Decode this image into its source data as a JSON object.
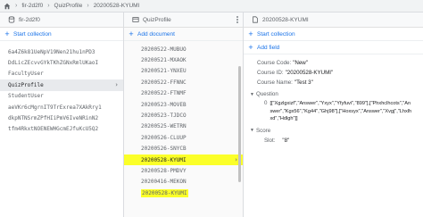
{
  "breadcrumb": [
    "fir-2d2f0",
    "QuizProfile",
    "20200528-KYUMI"
  ],
  "col1": {
    "title": "fir-2d2f0",
    "add_label": "Start collection",
    "items": [
      "6a4Z6k81UeNpV19Nen21hu1nPD3",
      "DdLicZEcvvGYkTKhZGNxRmlUKaoI",
      "FacultyUser",
      "QuizProfile",
      "StudentUser",
      "aeVKr6cMgrnIT9TrExrea7XAkRry1",
      "dkpNTNSrmZPfHIiPmV6IveNRinN2",
      "tfm4RkxtNOENEWHGcmEJfuKcU5Q2"
    ],
    "selected_index": 3
  },
  "col2": {
    "title": "QuizProfile",
    "add_label": "Add document",
    "items": [
      "20200522-MUBUO",
      "20200521-MXAOK",
      "20200521-YNXEU",
      "20200522-FFNNC",
      "20200522-FTNMF",
      "20200523-MOVEB",
      "20200523-TJDCO",
      "20200525-WETRN",
      "20200526-CLUUP",
      "20200526-SNYCB",
      "20200528-KYUMI",
      "20200528-PMDVY",
      "20200416-MEKON",
      "20200528-KYUMI"
    ]
  },
  "col3": {
    "title": "20200528-KYUMI",
    "start_collection": "Start collection",
    "add_field": "Add field",
    "fields": {
      "course_code": {
        "key": "Course Code:",
        "value": "\"New\""
      },
      "course_id": {
        "key": "Course ID:",
        "value": "\"20200528-KYUMI\""
      },
      "course_name": {
        "key": "Course Name:",
        "value": "\"Test 3\""
      },
      "question": {
        "key": "Question",
        "index": "0",
        "value": "[[\"Xgzlgxizf\",\"Answer\",\"Yxyx\",\"Yfyfuvi\",\"899\"],[\"Phxhclhcots\",\"Answer\",\"Kgx56\",\"Kg44\",\"Ghj98\"],[\"Hoxsyx\",\"Answer\",\"Xvgj\",\"Lhxlhxd\",\"Hdlgh\"]]"
      },
      "score": {
        "key": "Score",
        "slot_key": "Slot:",
        "slot_value": "\"8\""
      }
    }
  },
  "colors": {
    "accent": "#1a73e8",
    "highlight": "#fbff29",
    "selected": "#e8eaed"
  }
}
